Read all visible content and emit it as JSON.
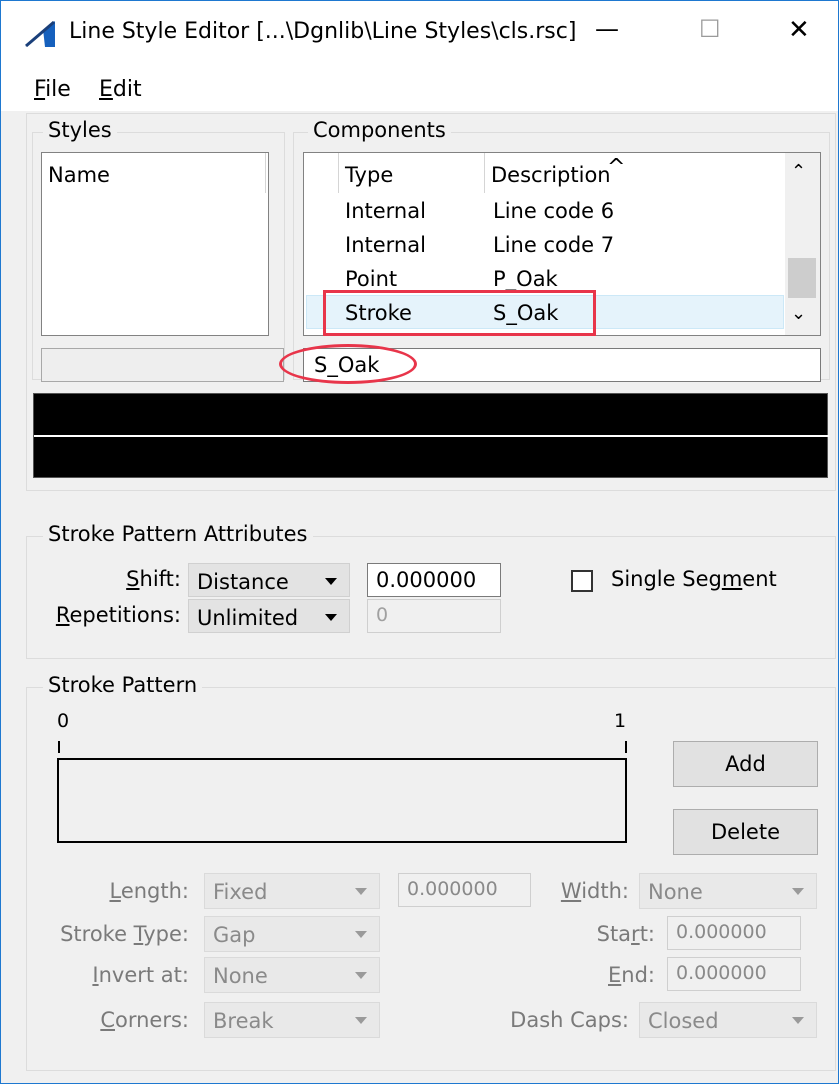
{
  "window": {
    "title": "Line Style Editor [...\\Dgnlib\\Line Styles\\cls.rsc]",
    "icon": "line-style-editor-icon",
    "minimize_glyph": "—",
    "maximize_glyph": "☐",
    "close_glyph": "✕"
  },
  "menu": {
    "file": {
      "pre": "",
      "key": "F",
      "post": "ile"
    },
    "edit": {
      "pre": "",
      "key": "E",
      "post": "dit"
    }
  },
  "styles": {
    "group_label": "Styles",
    "column_header": "Name",
    "name_field": ""
  },
  "components": {
    "group_label": "Components",
    "columns": {
      "type": "Type",
      "description": "Description"
    },
    "rows": [
      {
        "type": "Internal",
        "description": "Line code 6"
      },
      {
        "type": "Internal",
        "description": "Line code 7"
      },
      {
        "type": "Point",
        "description": "P_Oak"
      },
      {
        "type": "Stroke",
        "description": "S_Oak"
      }
    ],
    "selected_index": 3,
    "name_field": "S_Oak"
  },
  "attributes": {
    "group_label": "Stroke Pattern Attributes",
    "shift": {
      "pre": "",
      "key": "S",
      "post": "hift:",
      "value": "Distance",
      "number": "0.000000"
    },
    "repetitions": {
      "pre": "",
      "key": "R",
      "post": "epetitions:",
      "value": "Unlimited",
      "number": "0"
    },
    "single_segment": {
      "pre": "Single Seg",
      "key": "m",
      "post": "ent",
      "checked": false
    }
  },
  "pattern": {
    "group_label": "Stroke Pattern",
    "ruler_start": "0",
    "ruler_end": "1",
    "add_label": "Add",
    "delete_label": "Delete",
    "length": {
      "pre": "",
      "key": "L",
      "post": "ength:",
      "value": "Fixed",
      "number": "0.000000"
    },
    "width": {
      "pre": "",
      "key": "W",
      "post": "idth:",
      "value": "None"
    },
    "stroke_type": {
      "pre": "Stroke ",
      "key": "T",
      "post": "ype:",
      "value": "Gap"
    },
    "start": {
      "pre": "Sta",
      "key": "r",
      "post": "t:",
      "value": "0.000000"
    },
    "invert_at": {
      "pre": "",
      "key": "I",
      "post": "nvert at:",
      "value": "None"
    },
    "end": {
      "pre": "",
      "key": "E",
      "post": "nd:",
      "value": "0.000000"
    },
    "corners": {
      "pre": "",
      "key": "C",
      "post": "orners:",
      "value": "Break"
    },
    "dash_caps": {
      "pre": "Dash Caps:",
      "key": "",
      "post": "",
      "value": "Closed"
    }
  },
  "colors": {
    "highlight": "#e8354a",
    "selection": "#e5f3fb",
    "preview_bg": "#000000",
    "preview_line": "#ffffff"
  }
}
